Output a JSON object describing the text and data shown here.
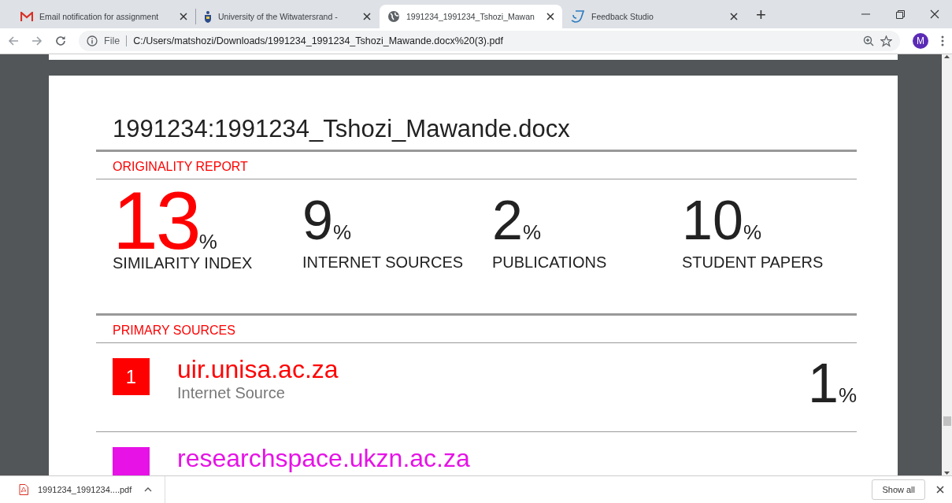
{
  "tabs": [
    {
      "kind": "mail",
      "title": "Email notification for assignment",
      "selected": false
    },
    {
      "kind": "crest",
      "title": "University of the Witwatersrand -",
      "selected": false
    },
    {
      "kind": "globe",
      "title": "1991234_1991234_Tshozi_Mawan",
      "selected": true
    },
    {
      "kind": "studio",
      "title": "Feedback Studio",
      "selected": false
    }
  ],
  "new_tab": "+",
  "address": {
    "scheme": "File",
    "url": "C:/Users/matshozi/Downloads/1991234_1991234_Tshozi_Mawande.docx%20(3).pdf"
  },
  "profile": {
    "initial": "M"
  },
  "report": {
    "title": "1991234:1991234_Tshozi_Mawande.docx",
    "originality_heading": "ORIGINALITY REPORT",
    "stats": [
      {
        "kind": "main",
        "value": "13",
        "unit": "%",
        "label": "SIMILARITY INDEX"
      },
      {
        "kind": "minor",
        "value": "9",
        "unit": "%",
        "label": "INTERNET SOURCES"
      },
      {
        "kind": "minor",
        "value": "2",
        "unit": "%",
        "label": "PUBLICATIONS"
      },
      {
        "kind": "minor",
        "value": "10",
        "unit": "%",
        "label": "STUDENT PAPERS"
      }
    ],
    "sources_heading": "PRIMARY SOURCES",
    "sources": [
      {
        "rank": "1",
        "domain": "uir.unisa.ac.za",
        "type": "Internet Source",
        "percent": "1",
        "unit": "%",
        "color": "#ff0000"
      },
      {
        "domain": "researchspace.ukzn.ac.za",
        "color": "#e612e6"
      }
    ]
  },
  "download": {
    "file": "1991234_1991234....pdf"
  },
  "show_all": "Show all"
}
